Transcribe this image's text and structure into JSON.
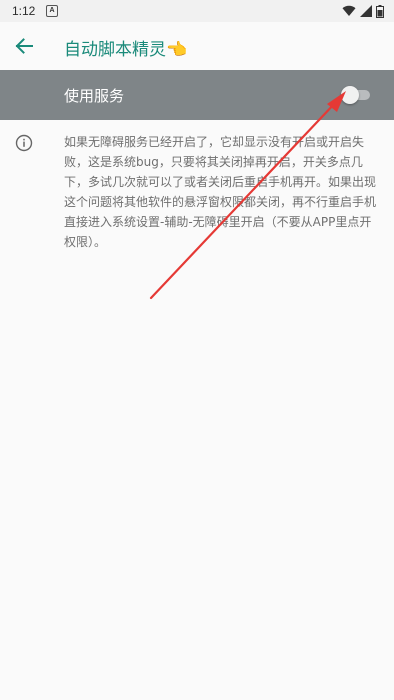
{
  "status_bar": {
    "time": "1:12",
    "notification_glyph": "A",
    "icons": [
      "wifi-icon",
      "signal-icon",
      "battery-icon"
    ]
  },
  "app_bar": {
    "title": "自动脚本精灵👈",
    "back_icon": "arrow-back-icon"
  },
  "service": {
    "label": "使用服务",
    "enabled": false
  },
  "info": {
    "icon": "info-icon",
    "text": "如果无障碍服务已经开启了，它却显示没有开启或开启失败，这是系统bug，只要将其关闭掉再开启，开关多点几下，多试几次就可以了或者关闭后重启手机再开。如果出现这个问题将其他软件的悬浮窗权限都关闭，再不行重启手机直接进入系统设置-辅助-无障碍里开启（不要从APP里点开权限）。"
  },
  "colors": {
    "accent": "#1a8a7a",
    "service_row_bg": "#7f8588",
    "annotation_arrow": "#e53935",
    "background": "#fafafa"
  }
}
